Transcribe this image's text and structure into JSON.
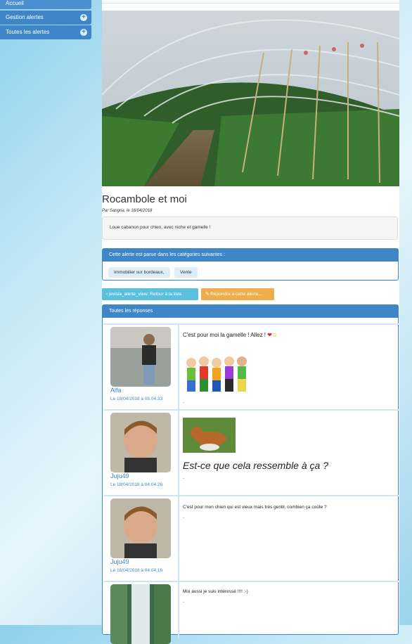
{
  "menu": {
    "items": [
      {
        "label": "Accueil"
      },
      {
        "label": "Gestion alertes"
      },
      {
        "label": "Toutes les alertes"
      }
    ]
  },
  "alert": {
    "title": "Rocambole et moi",
    "byline": "Par Sangria, le 16/04/2018",
    "description": "Loue cabanon pour chien, avec niche et gamelle !"
  },
  "categories": {
    "heading": "Cette alerte est parue dans les catégories suivantes :",
    "items": [
      "Immobilier sur bordeaux,",
      "Vente"
    ]
  },
  "buttons": {
    "back": "jevisla_alerte_view: Retour à la liste",
    "reply": "Répondre à cette alerte..."
  },
  "responses": {
    "heading": "Toutes les réponses",
    "items": [
      {
        "user": "Alfa",
        "date": "Le 18/04/2018 à 08.04.33",
        "text": "C'est pour moi la gamelle !  Allez !",
        "trail": "."
      },
      {
        "user": "Juju49",
        "date": "Le 18/04/2018 à 04.04.26",
        "text": "Est-ce que cela ressemble à ça ?",
        "trail": "."
      },
      {
        "user": "Juju49",
        "date": "Le 18/04/2018 à 04.04.16",
        "text": "C'est pour mon chien qui est vieux mais très gentil, combien ça coûte ?",
        "trail": "."
      },
      {
        "user": "",
        "date": "",
        "text": "Moi aussi je suis intéressé !!!!   :-)",
        "trail": "."
      }
    ]
  },
  "colors": {
    "primary": "#3f86c8",
    "info": "#5bc0de",
    "warning": "#f0ad4e"
  }
}
